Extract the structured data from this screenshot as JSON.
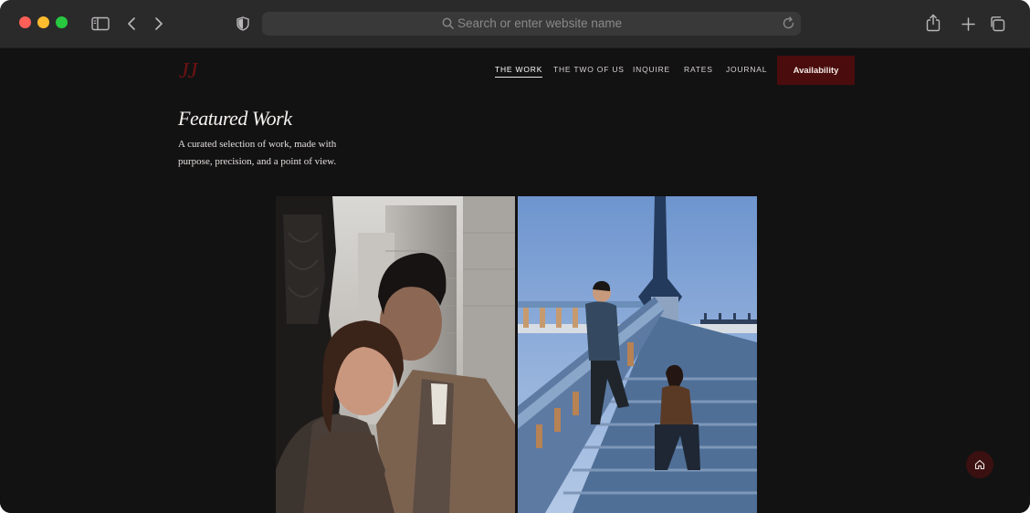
{
  "browser": {
    "address_placeholder": "Search or enter website name"
  },
  "site": {
    "logo": "JJ",
    "nav": [
      {
        "label": "THE WORK",
        "active": true
      },
      {
        "label": "THE TWO OF US",
        "active": false
      },
      {
        "label": "INQUIRE",
        "active": false
      },
      {
        "label": "RATES",
        "active": false
      },
      {
        "label": "JOURNAL",
        "active": false
      }
    ],
    "cta_label": "Availability"
  },
  "main": {
    "title": "Featured Work",
    "description": "A curated selection of work, made with purpose, precision, and a point of view."
  },
  "colors": {
    "page_bg": "#131213",
    "accent": "#4a0c0c",
    "logo": "#6e1212",
    "chrome": "#2b2a2b"
  },
  "icons": [
    "sidebar-icon",
    "back-chevron-icon",
    "forward-chevron-icon",
    "shield-icon",
    "search-icon",
    "reload-icon",
    "share-icon",
    "plus-icon",
    "tabs-icon",
    "home-icon"
  ]
}
